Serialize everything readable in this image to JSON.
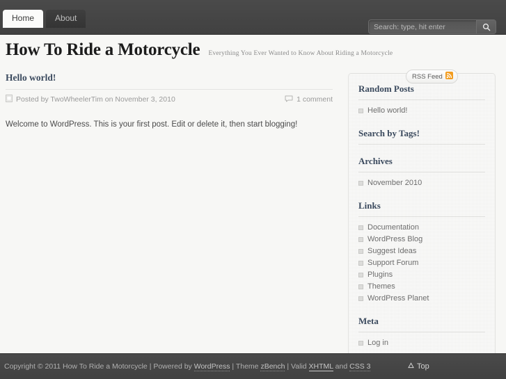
{
  "nav": {
    "tabs": [
      {
        "label": "Home",
        "active": true
      },
      {
        "label": "About",
        "active": false
      }
    ]
  },
  "search": {
    "placeholder": "Search: type, hit enter",
    "value": "",
    "icon": "search-icon"
  },
  "site": {
    "title": "How To Ride a Motorcycle",
    "tagline": "Everything You Ever Wanted to Know About Riding a Motorcycle"
  },
  "post": {
    "title": "Hello world!",
    "meta_text": "Posted by TwoWheelerTim on November 3, 2010",
    "meta_icon": "document-icon",
    "comments_text": "1 comment",
    "comments_icon": "comment-bubble-icon",
    "body": "Welcome to WordPress. This is your first post. Edit or delete it, then start blogging!"
  },
  "sidebar": {
    "rss_badge": {
      "label": "RSS Feed",
      "icon": "rss-icon",
      "color": "#f29c1f"
    },
    "widgets": [
      {
        "title": "Random Posts",
        "items": [
          "Hello world!"
        ]
      },
      {
        "title": "Search by Tags!",
        "items": []
      },
      {
        "title": "Archives",
        "items": [
          "November 2010"
        ]
      },
      {
        "title": "Links",
        "items": [
          "Documentation",
          "WordPress Blog",
          "Suggest Ideas",
          "Support Forum",
          "Plugins",
          "Themes",
          "WordPress Planet"
        ]
      },
      {
        "title": "Meta",
        "items": [
          "Log in"
        ]
      }
    ]
  },
  "footer": {
    "copyright_prefix": "Copyright © 2011 How To Ride a Motorcycle",
    "sep": " | ",
    "powered_by_prefix": "Powered by ",
    "powered_by_link": "WordPress",
    "theme_prefix": "Theme ",
    "theme_link": "zBench",
    "valid_prefix": "Valid ",
    "valid_link_1": "XHTML",
    "valid_mid": " and ",
    "valid_link_2": "CSS 3",
    "top_label": "Top",
    "top_icon": "triangle-up-icon"
  },
  "colors": {
    "header_bg": "#454545",
    "page_bg": "#f7f7f5",
    "heading": "#3b4a5e",
    "rss_orange": "#f29c1f"
  }
}
